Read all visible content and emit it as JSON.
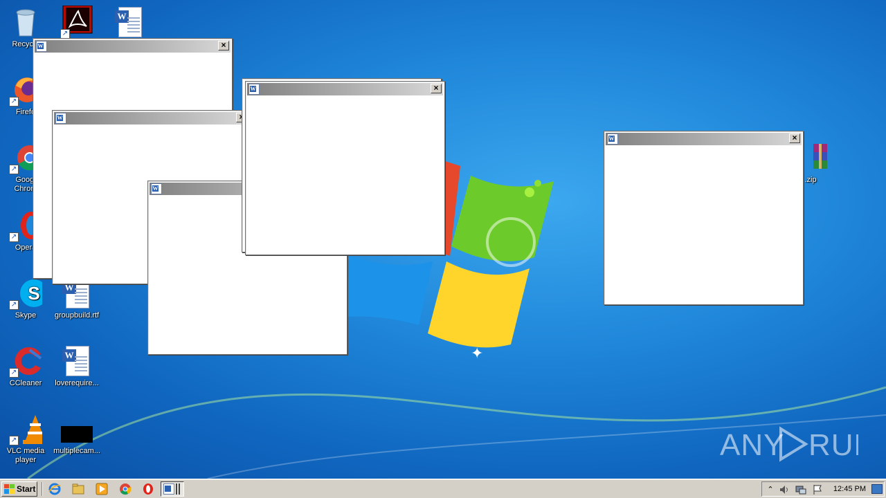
{
  "desktop": {
    "icons": [
      {
        "label": "Recycle",
        "icon": "recycle-bin-icon"
      },
      {
        "label": "Firefo",
        "icon": "firefox-icon"
      },
      {
        "label": "Googl",
        "label2": "Chrom",
        "icon": "chrome-icon"
      },
      {
        "label": "Opera",
        "icon": "opera-icon"
      },
      {
        "label": "Skype",
        "icon": "skype-icon"
      },
      {
        "label": "CCleaner",
        "icon": "ccleaner-icon"
      },
      {
        "label": "VLC media",
        "label2": "player",
        "icon": "vlc-icon"
      },
      {
        "label": "groupbuild.rtf",
        "icon": "word-document-icon"
      },
      {
        "label": "loverequire...",
        "icon": "word-document-icon"
      },
      {
        "label": "multiplecam...",
        "icon": "black-file-icon"
      },
      {
        "label": ".zip",
        "icon": "winrar-archive-icon"
      }
    ],
    "windows_count": 6
  },
  "taskbar": {
    "start_label": "Start",
    "clock": "12:45 PM",
    "quick_launch": [
      "internet-explorer-icon",
      "folder-icon",
      "media-player-icon",
      "chrome-icon",
      "opera-icon"
    ]
  },
  "watermark": "ANY RUN",
  "colors": {
    "taskbar": "#d4d0c8",
    "desktop": "#1f86d9"
  }
}
